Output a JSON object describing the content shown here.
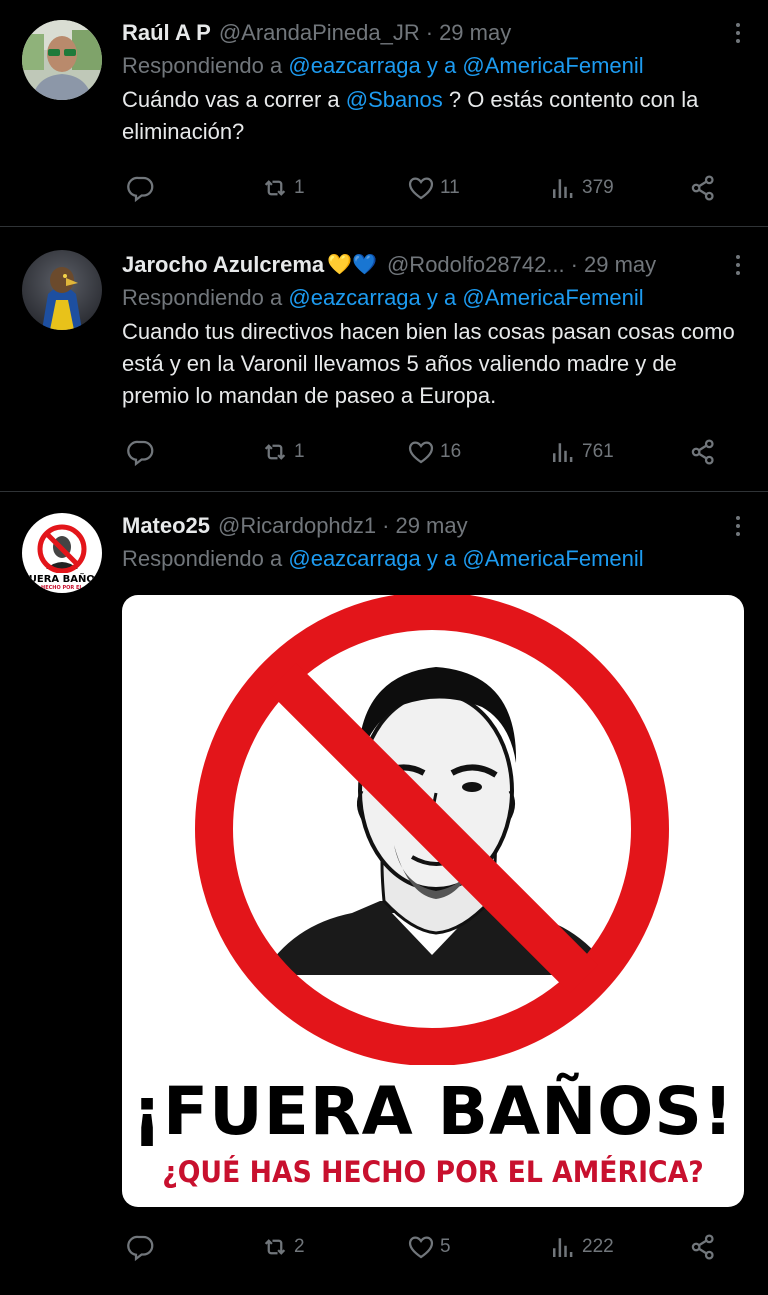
{
  "tweets": [
    {
      "name": "Raúl A P",
      "handle": "@ArandaPineda_JR",
      "separator": "·",
      "date": "29 may",
      "replying_prefix": "Respondiendo a",
      "mention1": "@eazcarraga",
      "replying_and": "y a",
      "mention2": "@AmericaFemenil",
      "text_before": "Cuándo vas a correr a ",
      "text_mention": "@Sbanos",
      "text_after": " ? O estás contento con la eliminación?",
      "replies": "",
      "retweets": "1",
      "likes": "11",
      "views": "379"
    },
    {
      "name": "Jarocho Azulcrema",
      "emoji": "💛💙",
      "handle": "@Rodolfo28742...",
      "separator": "·",
      "date": "29 may",
      "replying_prefix": "Respondiendo a",
      "mention1": "@eazcarraga",
      "replying_and": "y a",
      "mention2": "@AmericaFemenil",
      "text": "Cuando tus directivos hacen bien las cosas pasan cosas como está y en la Varonil llevamos 5 años valiendo madre y de premio lo mandan de paseo a Europa.",
      "replies": "",
      "retweets": "1",
      "likes": "16",
      "views": "761"
    },
    {
      "name": "Mateo25",
      "handle": "@Ricardophdz1",
      "separator": "·",
      "date": "29 may",
      "replying_prefix": "Respondiendo a",
      "mention1": "@eazcarraga",
      "replying_and": "y a",
      "mention2": "@AmericaFemenil",
      "image_headline": "¡FUERA BAÑOS!",
      "image_subheadline": "¿QUÉ HAS HECHO POR EL AMÉRICA?",
      "replies": "",
      "retweets": "2",
      "likes": "5",
      "views": "222"
    }
  ],
  "colors": {
    "background": "#000000",
    "text": "#e7e9ea",
    "muted": "#71767b",
    "mention": "#1d9bf0",
    "divider": "#2f3336",
    "prohibition_red": "#e3151a",
    "subheadline_red": "#c8102e"
  },
  "icons": [
    "reply-icon",
    "retweet-icon",
    "like-icon",
    "views-icon",
    "share-icon",
    "more-icon"
  ]
}
